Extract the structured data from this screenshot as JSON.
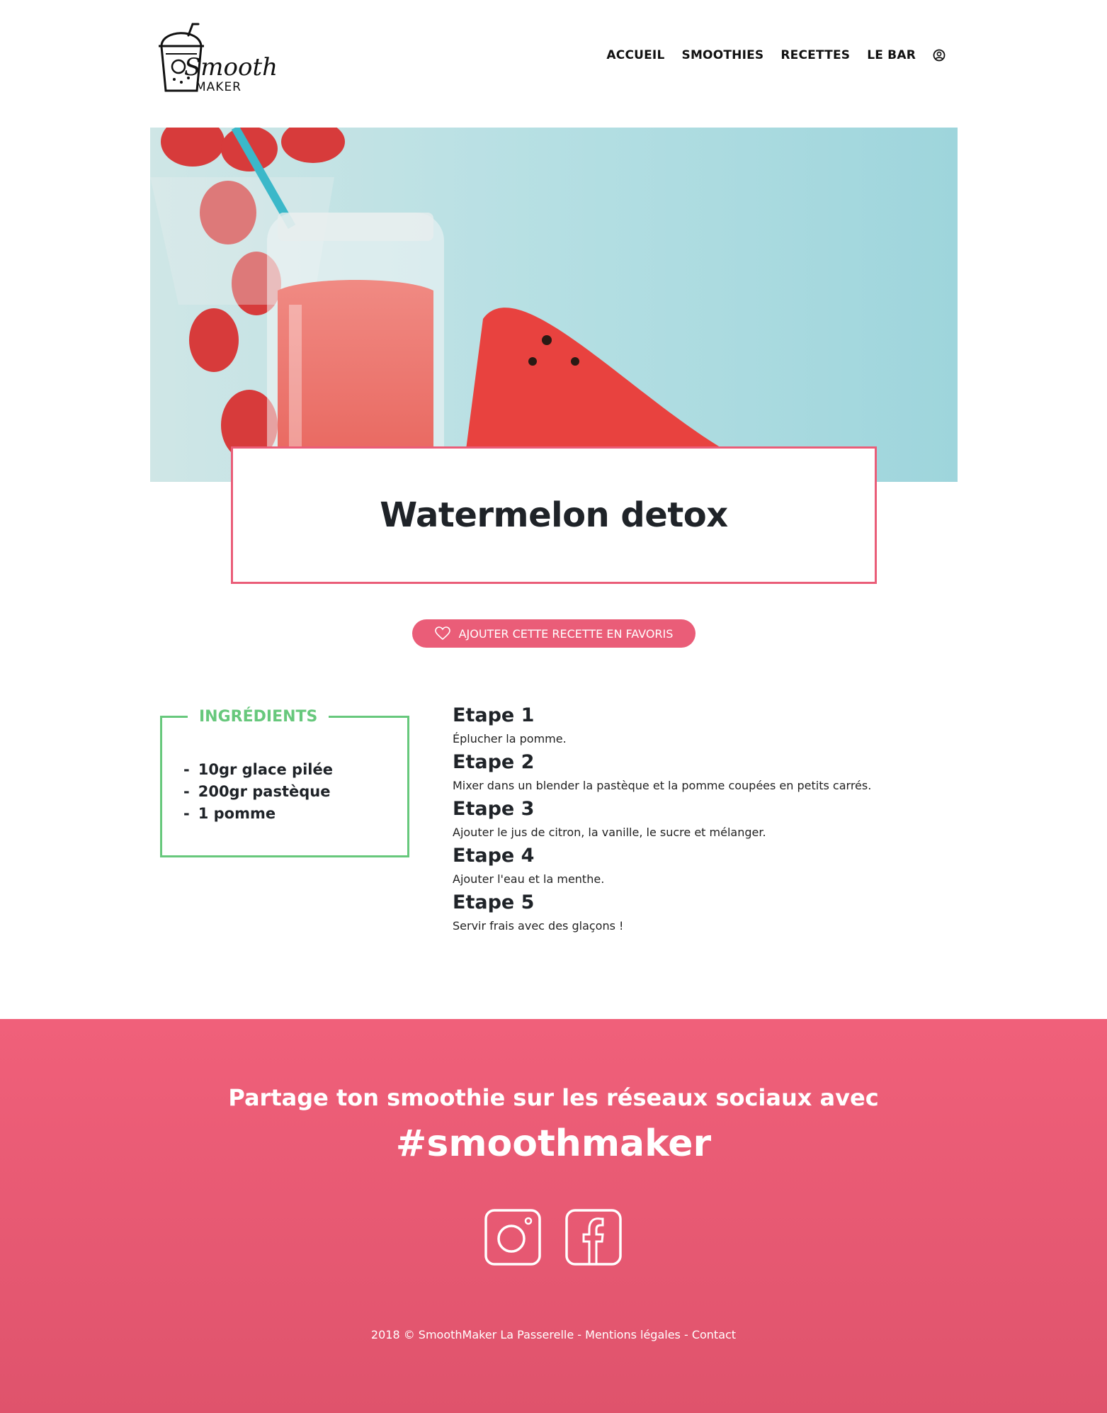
{
  "brand": {
    "logo_script": "Smooth",
    "logo_sub": "MAKER"
  },
  "nav": {
    "items": [
      {
        "label": "ACCUEIL"
      },
      {
        "label": "SMOOTHIES"
      },
      {
        "label": "RECETTES"
      },
      {
        "label": "LE BAR"
      }
    ],
    "user_icon": "user-circle-icon"
  },
  "recipe": {
    "title": "Watermelon detox",
    "favorite_label": "AJOUTER CETTE RECETTE EN FAVORIS",
    "ingredients_title": "INGRÉDIENTS",
    "ingredients": [
      "10gr glace pilée",
      "200gr pastèque",
      "1 pomme"
    ],
    "steps": [
      {
        "title": "Etape 1",
        "text": "Éplucher la pomme."
      },
      {
        "title": "Etape 2",
        "text": "Mixer dans un blender la pastèque et la pomme coupées en petits carrés."
      },
      {
        "title": "Etape 3",
        "text": "Ajouter le jus de citron, la vanille, le sucre et mélanger."
      },
      {
        "title": "Etape 4",
        "text": "Ajouter l'eau et la menthe."
      },
      {
        "title": "Etape 5",
        "text": "Servir frais avec des glaçons !"
      }
    ]
  },
  "footer": {
    "share_text": "Partage ton smoothie sur les réseaux sociaux avec",
    "hashtag": "#smoothmaker",
    "socials": [
      "instagram-icon",
      "facebook-icon"
    ],
    "copyright": "2018 © SmoothMaker La Passerelle - Mentions légales - Contact"
  },
  "colors": {
    "accent_pink": "#ea5d78",
    "accent_green": "#67c87c",
    "footer_top": "#f0607a",
    "footer_bottom": "#df536c"
  }
}
